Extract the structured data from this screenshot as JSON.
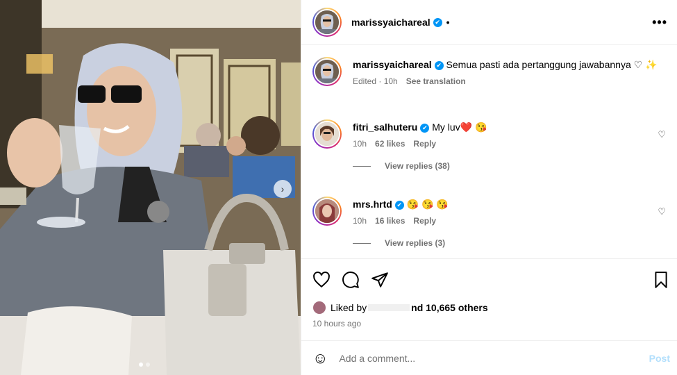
{
  "post": {
    "author": "marissyaichareal",
    "header_dot": "•",
    "more_label": "•••",
    "carousel_next": "›",
    "caption": "Semua pasti ada pertanggung jawabannya ♡ ✨",
    "caption_meta": {
      "edited": "Edited · 10h",
      "see_translation": "See translation"
    }
  },
  "comments": [
    {
      "username": "fitri_salhuteru",
      "text": "My luv❤️ 😘",
      "time": "10h",
      "likes": "62 likes",
      "reply": "Reply",
      "view_replies": "View replies (38)"
    },
    {
      "username": "mrs.hrtd",
      "text": "😘 😘 😘",
      "time": "10h",
      "likes": "16 likes",
      "reply": "Reply",
      "view_replies": "View replies (3)"
    }
  ],
  "likes": {
    "prefix": "Liked by",
    "suffix": "nd 10,665 others",
    "time_ago": "10 hours ago"
  },
  "composer": {
    "placeholder": "Add a comment...",
    "post_label": "Post",
    "emoji_icon": "☺"
  },
  "icons": {
    "verified": "✔",
    "comment_heart": "♡"
  },
  "colors": {
    "accent": "#0095f6",
    "post_disabled": "#b2dffc",
    "muted": "#737373"
  }
}
